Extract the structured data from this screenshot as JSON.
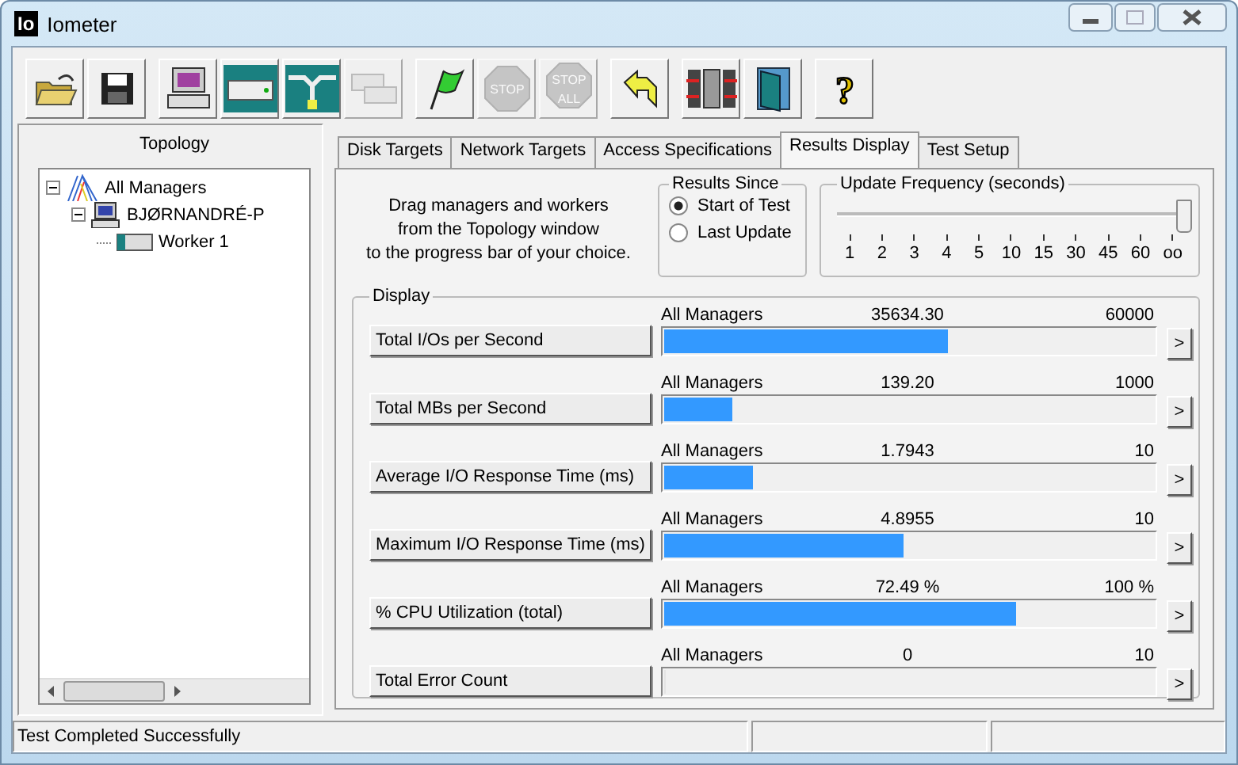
{
  "window": {
    "title": "Iometer",
    "app_icon": "Io"
  },
  "toolbar": [
    [
      {
        "kind": "open",
        "disabled": false
      },
      {
        "kind": "save",
        "disabled": false
      }
    ],
    [
      {
        "kind": "computer",
        "disabled": false
      },
      {
        "kind": "disk",
        "disabled": false
      },
      {
        "kind": "network",
        "disabled": false
      },
      {
        "kind": "copy",
        "disabled": true
      }
    ],
    [
      {
        "kind": "flag",
        "disabled": false
      },
      {
        "kind": "stop",
        "disabled": true,
        "text": "STOP"
      },
      {
        "kind": "stopall",
        "disabled": true,
        "text": "STOP",
        "text2": "ALL"
      }
    ],
    [
      {
        "kind": "reset",
        "disabled": false
      }
    ],
    [
      {
        "kind": "split",
        "disabled": false
      },
      {
        "kind": "exit",
        "disabled": false
      }
    ],
    [
      {
        "kind": "help",
        "disabled": false,
        "text": "?"
      }
    ]
  ],
  "topology": {
    "title": "Topology",
    "tree": [
      {
        "label": "All Managers",
        "kind": "managers",
        "expanded": true,
        "children": [
          {
            "label": "BJØRNANDRÉ-P",
            "kind": "computer",
            "expanded": true,
            "children": [
              {
                "label": "Worker 1",
                "kind": "worker"
              }
            ]
          }
        ]
      }
    ]
  },
  "tabs": [
    {
      "label": "Disk Targets",
      "selected": false
    },
    {
      "label": "Network Targets",
      "selected": false
    },
    {
      "label": "Access Specifications",
      "selected": false
    },
    {
      "label": "Results Display",
      "selected": true
    },
    {
      "label": "Test Setup",
      "selected": false
    }
  ],
  "instructions": [
    "Drag managers and workers",
    "from the Topology window",
    "to the progress bar of your choice."
  ],
  "results_since": {
    "title": "Results Since",
    "options": [
      {
        "label": "Start of Test",
        "selected": true
      },
      {
        "label": "Last Update",
        "selected": false
      }
    ]
  },
  "update_frequency": {
    "title": "Update Frequency (seconds)",
    "level": 1,
    "ticks": [
      "1",
      "2",
      "3",
      "4",
      "5",
      "10",
      "15",
      "30",
      "45",
      "60",
      "oo"
    ]
  },
  "display": {
    "title": "Display",
    "rows": [
      {
        "label": "Total I/Os per Second",
        "target": "All Managers",
        "value": "35634.30",
        "max": "60000",
        "level": 0.58,
        "arrow": ">"
      },
      {
        "label": "Total MBs per Second",
        "target": "All Managers",
        "value": "139.20",
        "max": "1000",
        "level": 0.14,
        "arrow": ">"
      },
      {
        "label": "Average I/O Response Time (ms)",
        "target": "All Managers",
        "value": "1.7943",
        "max": "10",
        "level": 0.18,
        "arrow": ">"
      },
      {
        "label": "Maximum I/O Response Time (ms)",
        "target": "All Managers",
        "value": "4.8955",
        "max": "10",
        "level": 0.49,
        "arrow": ">"
      },
      {
        "label": "% CPU Utilization (total)",
        "target": "All Managers",
        "value": "72.49 %",
        "max": "100 %",
        "level": 0.72,
        "arrow": ">"
      },
      {
        "label": "Total Error Count",
        "target": "All Managers",
        "value": "0",
        "max": "10",
        "level": 0,
        "arrow": ">"
      }
    ]
  },
  "status_bar": {
    "text": "Test Completed Successfully"
  }
}
